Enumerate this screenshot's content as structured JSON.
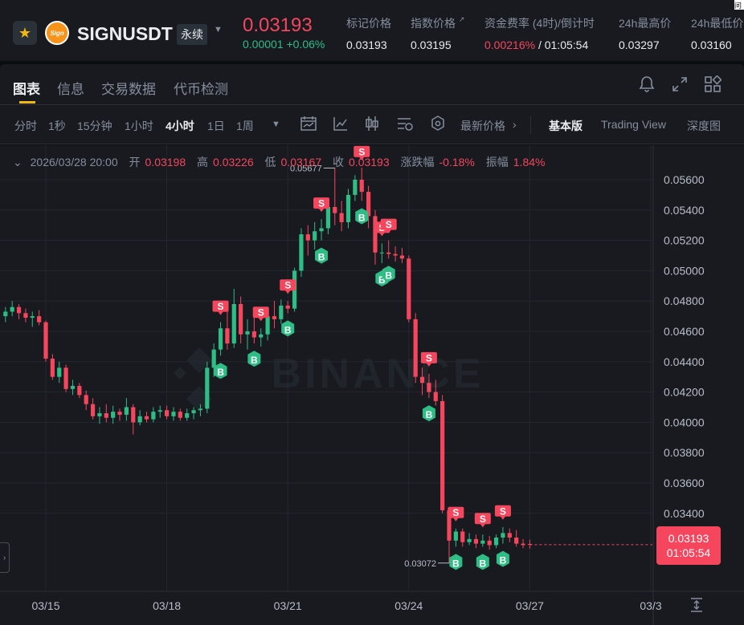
{
  "ticker": {
    "symbol": "SIGNUSDT",
    "contract_type": "永续",
    "coin_logo_text": "Sign",
    "last_price": "0.03193",
    "change_abs": "0.00001",
    "change_pct": "+0.06%",
    "mark_price_label": "标记价格",
    "mark_price": "0.03193",
    "index_price_label": "指数价格",
    "index_price": "0.03195",
    "funding_label": "资金费率 (4时)/倒计时",
    "funding_rate": "0.00216%",
    "funding_countdown": "/ 01:05:54",
    "high_label": "24h最高价",
    "high": "0.03297",
    "low_label": "24h最低价",
    "low": "0.03160",
    "corner_text": "问"
  },
  "tabs": {
    "items": [
      "图表",
      "信息",
      "交易数据",
      "代币检测"
    ]
  },
  "toolbar": {
    "intervals": [
      "分时",
      "1秒",
      "15分钟",
      "1小时",
      "4小时",
      "1日",
      "1周"
    ],
    "active_interval": "4小时",
    "price_type": "最新价格",
    "views": [
      "基本版",
      "Trading View",
      "深度图"
    ],
    "active_view": "基本版"
  },
  "ohlc": {
    "timestamp": "2026/03/28 20:00",
    "open_label": "开",
    "open": "0.03198",
    "high_label": "高",
    "high": "0.03226",
    "low_label": "低",
    "low": "0.03167",
    "close_label": "收",
    "close": "0.03193",
    "change_label": "涨跌幅",
    "change": "-0.18%",
    "amplitude_label": "振幅",
    "amplitude": "1.84%"
  },
  "price_tag": {
    "price": "0.03193",
    "countdown": "01:05:54"
  },
  "watermark": "BINANCE",
  "colors": {
    "up": "#2ebd85",
    "down": "#f6465d",
    "accent": "#f0b90b",
    "background": "#181a20"
  },
  "chart_data": {
    "type": "candlestick",
    "interval": "4h",
    "yaxis_ticks": [
      "0.05600",
      "0.05400",
      "0.05200",
      "0.05000",
      "0.04800",
      "0.04600",
      "0.04400",
      "0.04200",
      "0.04000",
      "0.03800",
      "0.03600",
      "0.03400"
    ],
    "xaxis_ticks": [
      {
        "label": "03/15",
        "day": 15
      },
      {
        "label": "03/18",
        "day": 18
      },
      {
        "label": "03/21",
        "day": 21
      },
      {
        "label": "03/24",
        "day": 24
      },
      {
        "label": "03/27",
        "day": 27
      },
      {
        "label": "03/3",
        "day": 30
      }
    ],
    "ylim": [
      0.0317,
      0.0577
    ],
    "period_high": "0.05677",
    "period_low": "0.03072",
    "ohlc": [
      [
        0.047,
        0.0476,
        0.0466,
        0.0473
      ],
      [
        0.0473,
        0.048,
        0.047,
        0.0476
      ],
      [
        0.0476,
        0.0478,
        0.0468,
        0.0472
      ],
      [
        0.0472,
        0.0475,
        0.0466,
        0.0469
      ],
      [
        0.0469,
        0.0473,
        0.0463,
        0.047
      ],
      [
        0.047,
        0.0474,
        0.0464,
        0.0466
      ],
      [
        0.0466,
        0.0467,
        0.044,
        0.0442
      ],
      [
        0.0442,
        0.0445,
        0.0428,
        0.043
      ],
      [
        0.043,
        0.044,
        0.0426,
        0.0436
      ],
      [
        0.0436,
        0.0438,
        0.042,
        0.0422
      ],
      [
        0.0422,
        0.0428,
        0.0418,
        0.0424
      ],
      [
        0.0424,
        0.0426,
        0.0416,
        0.0418
      ],
      [
        0.0418,
        0.0421,
        0.0408,
        0.0412
      ],
      [
        0.0412,
        0.0416,
        0.0402,
        0.0404
      ],
      [
        0.0404,
        0.041,
        0.0399,
        0.0406
      ],
      [
        0.0406,
        0.0412,
        0.04,
        0.0403
      ],
      [
        0.0403,
        0.0411,
        0.0399,
        0.0407
      ],
      [
        0.0407,
        0.0409,
        0.0401,
        0.0405
      ],
      [
        0.0405,
        0.0416,
        0.0401,
        0.041
      ],
      [
        0.041,
        0.0412,
        0.0392,
        0.04
      ],
      [
        0.04,
        0.0408,
        0.0398,
        0.0404
      ],
      [
        0.0404,
        0.0407,
        0.04,
        0.0402
      ],
      [
        0.0402,
        0.041,
        0.04,
        0.0407
      ],
      [
        0.0407,
        0.0411,
        0.0403,
        0.0408
      ],
      [
        0.0408,
        0.0411,
        0.0402,
        0.0404
      ],
      [
        0.0404,
        0.041,
        0.0401,
        0.0407
      ],
      [
        0.0407,
        0.0409,
        0.0401,
        0.0403
      ],
      [
        0.0403,
        0.0409,
        0.0401,
        0.0406
      ],
      [
        0.0406,
        0.041,
        0.0402,
        0.0408
      ],
      [
        0.0408,
        0.0412,
        0.0404,
        0.0409
      ],
      [
        0.0409,
        0.044,
        0.0406,
        0.0436
      ],
      [
        0.0436,
        0.0452,
        0.043,
        0.0448
      ],
      [
        0.0448,
        0.0466,
        0.0444,
        0.0462
      ],
      [
        0.0462,
        0.0475,
        0.0448,
        0.0452
      ],
      [
        0.0452,
        0.0488,
        0.0449,
        0.0478
      ],
      [
        0.0478,
        0.0483,
        0.0452,
        0.0458
      ],
      [
        0.0458,
        0.0468,
        0.0448,
        0.046
      ],
      [
        0.046,
        0.047,
        0.0452,
        0.0456
      ],
      [
        0.0456,
        0.0462,
        0.045,
        0.0458
      ],
      [
        0.0458,
        0.0474,
        0.0454,
        0.047
      ],
      [
        0.047,
        0.048,
        0.0462,
        0.0468
      ],
      [
        0.0468,
        0.0481,
        0.0465,
        0.0477
      ],
      [
        0.0477,
        0.048,
        0.0472,
        0.0475
      ],
      [
        0.0475,
        0.0502,
        0.0473,
        0.05
      ],
      [
        0.05,
        0.0528,
        0.0496,
        0.0524
      ],
      [
        0.0524,
        0.053,
        0.051,
        0.052
      ],
      [
        0.052,
        0.0532,
        0.0514,
        0.0526
      ],
      [
        0.0526,
        0.0534,
        0.052,
        0.0528
      ],
      [
        0.0528,
        0.0546,
        0.0524,
        0.0542
      ],
      [
        0.0542,
        0.0568,
        0.053,
        0.0538
      ],
      [
        0.0538,
        0.0546,
        0.0526,
        0.0532
      ],
      [
        0.0532,
        0.0554,
        0.0528,
        0.055
      ],
      [
        0.055,
        0.0563,
        0.0546,
        0.056
      ],
      [
        0.056,
        0.0568,
        0.0546,
        0.0552
      ],
      [
        0.0552,
        0.0556,
        0.0528,
        0.0536
      ],
      [
        0.0536,
        0.054,
        0.0504,
        0.0512
      ],
      [
        0.0512,
        0.0518,
        0.0505,
        0.0512
      ],
      [
        0.0512,
        0.052,
        0.0508,
        0.0511
      ],
      [
        0.0511,
        0.0516,
        0.0506,
        0.051
      ],
      [
        0.051,
        0.0515,
        0.0505,
        0.0508
      ],
      [
        0.0508,
        0.051,
        0.0466,
        0.0468
      ],
      [
        0.0468,
        0.0472,
        0.0426,
        0.043
      ],
      [
        0.043,
        0.0436,
        0.0418,
        0.0426
      ],
      [
        0.0426,
        0.0432,
        0.0416,
        0.042
      ],
      [
        0.042,
        0.0428,
        0.0411,
        0.0414
      ],
      [
        0.0414,
        0.0418,
        0.034,
        0.0342
      ],
      [
        0.0342,
        0.0344,
        0.0307,
        0.0322
      ],
      [
        0.0322,
        0.033,
        0.0318,
        0.0328
      ],
      [
        0.0328,
        0.033,
        0.0318,
        0.0321
      ],
      [
        0.0321,
        0.0327,
        0.0319,
        0.0323
      ],
      [
        0.0323,
        0.0326,
        0.0317,
        0.032
      ],
      [
        0.032,
        0.0326,
        0.0318,
        0.0322
      ],
      [
        0.0322,
        0.0325,
        0.0316,
        0.0319
      ],
      [
        0.0319,
        0.0326,
        0.0317,
        0.0324
      ],
      [
        0.0324,
        0.0331,
        0.032,
        0.0327
      ],
      [
        0.0327,
        0.033,
        0.0321,
        0.0324
      ],
      [
        0.0324,
        0.0329,
        0.0318,
        0.032
      ],
      [
        0.032,
        0.0323,
        0.0317,
        0.0319
      ],
      [
        0.03198,
        0.03226,
        0.03167,
        0.03193
      ]
    ],
    "signals": [
      {
        "type": "S",
        "bar": 32
      },
      {
        "type": "B",
        "bar": 32
      },
      {
        "type": "S",
        "bar": 38
      },
      {
        "type": "B",
        "bar": 37
      },
      {
        "type": "S",
        "bar": 42
      },
      {
        "type": "B",
        "bar": 42
      },
      {
        "type": "S",
        "bar": 47
      },
      {
        "type": "B",
        "bar": 47
      },
      {
        "type": "S",
        "bar": 53
      },
      {
        "type": "B",
        "bar": 53
      },
      {
        "type": "S",
        "bar": 56
      },
      {
        "type": "B",
        "bar": 56
      },
      {
        "type": "S",
        "bar": 57
      },
      {
        "type": "B",
        "bar": 57
      },
      {
        "type": "S",
        "bar": 63
      },
      {
        "type": "B",
        "bar": 63
      },
      {
        "type": "S",
        "bar": 67
      },
      {
        "type": "B",
        "bar": 67
      },
      {
        "type": "S",
        "bar": 71
      },
      {
        "type": "B",
        "bar": 71
      },
      {
        "type": "S",
        "bar": 74
      },
      {
        "type": "B",
        "bar": 74
      }
    ]
  }
}
